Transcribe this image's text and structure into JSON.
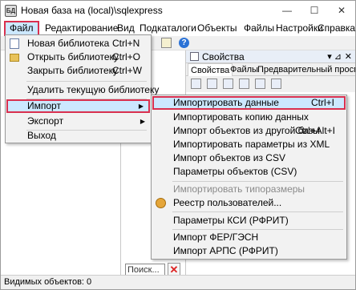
{
  "window": {
    "title": "Новая база на (local)\\sqlexpress",
    "app_icon_text": "БД",
    "minimize": "—",
    "maximize": "☐",
    "close": "✕"
  },
  "menubar": [
    "Файл",
    "Редактирование",
    "Вид",
    "Подкаталоги",
    "Объекты",
    "Файлы",
    "Настройки",
    "Справка"
  ],
  "toolbar": {
    "help_icon": "?"
  },
  "properties_panel": {
    "title": "Свойства",
    "pin": "▾ ⊿",
    "close": "✕",
    "tabs": [
      "Свойства",
      "Файлы",
      "Предварительный просмотр"
    ]
  },
  "file_menu": {
    "items": [
      {
        "label": "Новая библиотека",
        "shortcut": "Ctrl+N",
        "icon": "new-doc-icon"
      },
      {
        "label": "Открыть библиотеку",
        "shortcut": "Ctrl+O",
        "icon": "open-folder-icon"
      },
      {
        "label": "Закрыть библиотеку",
        "shortcut": "Ctrl+W"
      },
      {
        "label": "Удалить текущую библиотеку"
      },
      {
        "label": "Импорт",
        "submenu": true
      },
      {
        "label": "Экспорт",
        "submenu": true
      },
      {
        "label": "Выход"
      }
    ]
  },
  "import_menu": {
    "items": [
      {
        "label": "Импортировать данные",
        "shortcut": "Ctrl+I"
      },
      {
        "label": "Импортировать копию данных"
      },
      {
        "label": "Импорт объектов из другой базы",
        "shortcut": "Ctrl+Alt+I"
      },
      {
        "label": "Импортировать параметры из XML"
      },
      {
        "label": "Импорт объектов из CSV"
      },
      {
        "label": "Параметры объектов (CSV)"
      },
      {
        "label": "Импортировать типоразмеры",
        "disabled": true
      },
      {
        "label": "Реестр пользователей...",
        "icon": "registry-icon"
      },
      {
        "label": "Параметры КСИ (РФРИТ)"
      },
      {
        "label": "Импорт ФЕР/ГЭСН"
      },
      {
        "label": "Импорт АРПС (РФРИТ)"
      }
    ]
  },
  "search": {
    "placeholder": "Поиск...",
    "clear": "✕"
  },
  "status": {
    "text": "Видимых объектов: 0"
  },
  "colors": {
    "highlight": "#cce8ff",
    "border_accent": "#d9304f"
  }
}
